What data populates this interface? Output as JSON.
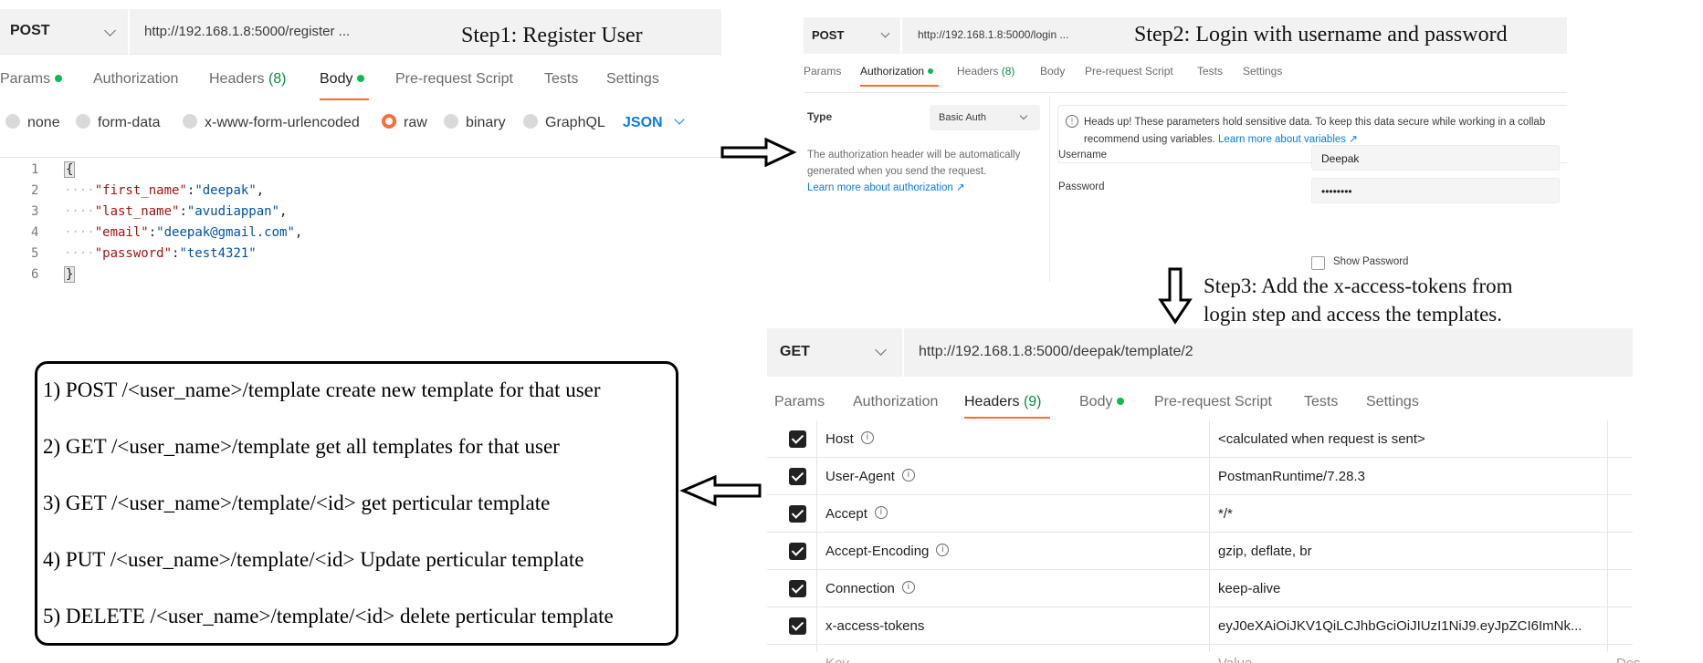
{
  "panel1": {
    "method": "POST",
    "url": "http://192.168.1.8:5000/register ...",
    "step_caption": "Step1: Register User",
    "tabs": [
      {
        "label": "Params",
        "count": ""
      },
      {
        "label": "Authorization",
        "count": ""
      },
      {
        "label": "Headers",
        "count": "(8)"
      },
      {
        "label": "Body",
        "count": ""
      },
      {
        "label": "Pre-request Script",
        "count": ""
      },
      {
        "label": "Tests",
        "count": ""
      },
      {
        "label": "Settings",
        "count": ""
      }
    ],
    "active_tab": "Body",
    "body_types": [
      "none",
      "form-data",
      "x-www-form-urlencoded",
      "raw",
      "binary",
      "GraphQL"
    ],
    "selected_body_type": "raw",
    "language": "JSON",
    "code": {
      "line_numbers": [
        "1",
        "2",
        "3",
        "4",
        "5",
        "6"
      ],
      "open": "{",
      "close": "}",
      "fields": [
        {
          "key": "\"first_name\"",
          "value": "\"deepak\"",
          "sep": ","
        },
        {
          "key": "\"last_name\"",
          "value": "\"avudiappan\"",
          "sep": ","
        },
        {
          "key": "\"email\"",
          "value": "\"deepak@gmail.com\"",
          "sep": ","
        },
        {
          "key": "\"password\"",
          "value": "\"test4321\"",
          "sep": ""
        }
      ]
    }
  },
  "panel2": {
    "method": "POST",
    "url": "http://192.168.1.8:5000/login ...",
    "step_caption": "Step2: Login with username and password",
    "tabs": [
      {
        "label": "Params",
        "count": ""
      },
      {
        "label": "Authorization",
        "count": ""
      },
      {
        "label": "Headers",
        "count": "(8)"
      },
      {
        "label": "Body",
        "count": ""
      },
      {
        "label": "Pre-request Script",
        "count": ""
      },
      {
        "label": "Tests",
        "count": ""
      },
      {
        "label": "Settings",
        "count": ""
      }
    ],
    "active_tab": "Authorization",
    "type_label": "Type",
    "auth_type": "Basic Auth",
    "help_text": "The authorization header will be automatically generated when you send the request.",
    "help_link": "Learn more about authorization ↗",
    "warning_text": "Heads up! These parameters hold sensitive data. To keep this data secure while working in a collab",
    "warning_text2": "recommend using variables.",
    "warning_link": "Learn more about variables ↗",
    "username_label": "Username",
    "username_value": "Deepak",
    "password_label": "Password",
    "password_value": "••••••••",
    "show_password_label": "Show Password"
  },
  "panel3": {
    "method": "GET",
    "url": "http://192.168.1.8:5000/deepak/template/2",
    "tabs": [
      {
        "label": "Params",
        "count": ""
      },
      {
        "label": "Authorization",
        "count": ""
      },
      {
        "label": "Headers",
        "count": "(9)"
      },
      {
        "label": "Body",
        "count": ""
      },
      {
        "label": "Pre-request Script",
        "count": ""
      },
      {
        "label": "Tests",
        "count": ""
      },
      {
        "label": "Settings",
        "count": ""
      }
    ],
    "active_tab": "Headers",
    "headers": [
      {
        "key": "Host",
        "value": "<calculated when request is sent>",
        "info": true
      },
      {
        "key": "User-Agent",
        "value": "PostmanRuntime/7.28.3",
        "info": true
      },
      {
        "key": "Accept",
        "value": "*/*",
        "info": true
      },
      {
        "key": "Accept-Encoding",
        "value": "gzip, deflate, br",
        "info": true
      },
      {
        "key": "Connection",
        "value": "keep-alive",
        "info": true
      },
      {
        "key": "x-access-tokens",
        "value": "eyJ0eXAiOiJKV1QiLCJhbGciOiJIUzI1NiJ9.eyJpZCI6ImNk...",
        "info": false
      }
    ],
    "placeholder_key": "Key",
    "placeholder_value": "Value",
    "placeholder_desc": "Des"
  },
  "step3_caption": [
    "Step3: Add the x-access-tokens from",
    "login step and access the templates."
  ],
  "endpoints": [
    "1) POST /<user_name>/template create new template for that user",
    "2) GET /<user_name>/template get all templates for that user",
    "3) GET /<user_name>/template/<id> get perticular template",
    "4) PUT /<user_name>/template/<id> Update perticular template",
    "5) DELETE /<user_name>/template/<id> delete perticular template"
  ],
  "colors": {
    "accent": "#ff6c37",
    "link": "#097bed",
    "success": "#0cbb52"
  },
  "icons": [
    "chevron-down-icon",
    "info-icon",
    "checkbox-checked-icon",
    "arrow-right-icon",
    "arrow-down-icon",
    "arrow-left-icon"
  ]
}
